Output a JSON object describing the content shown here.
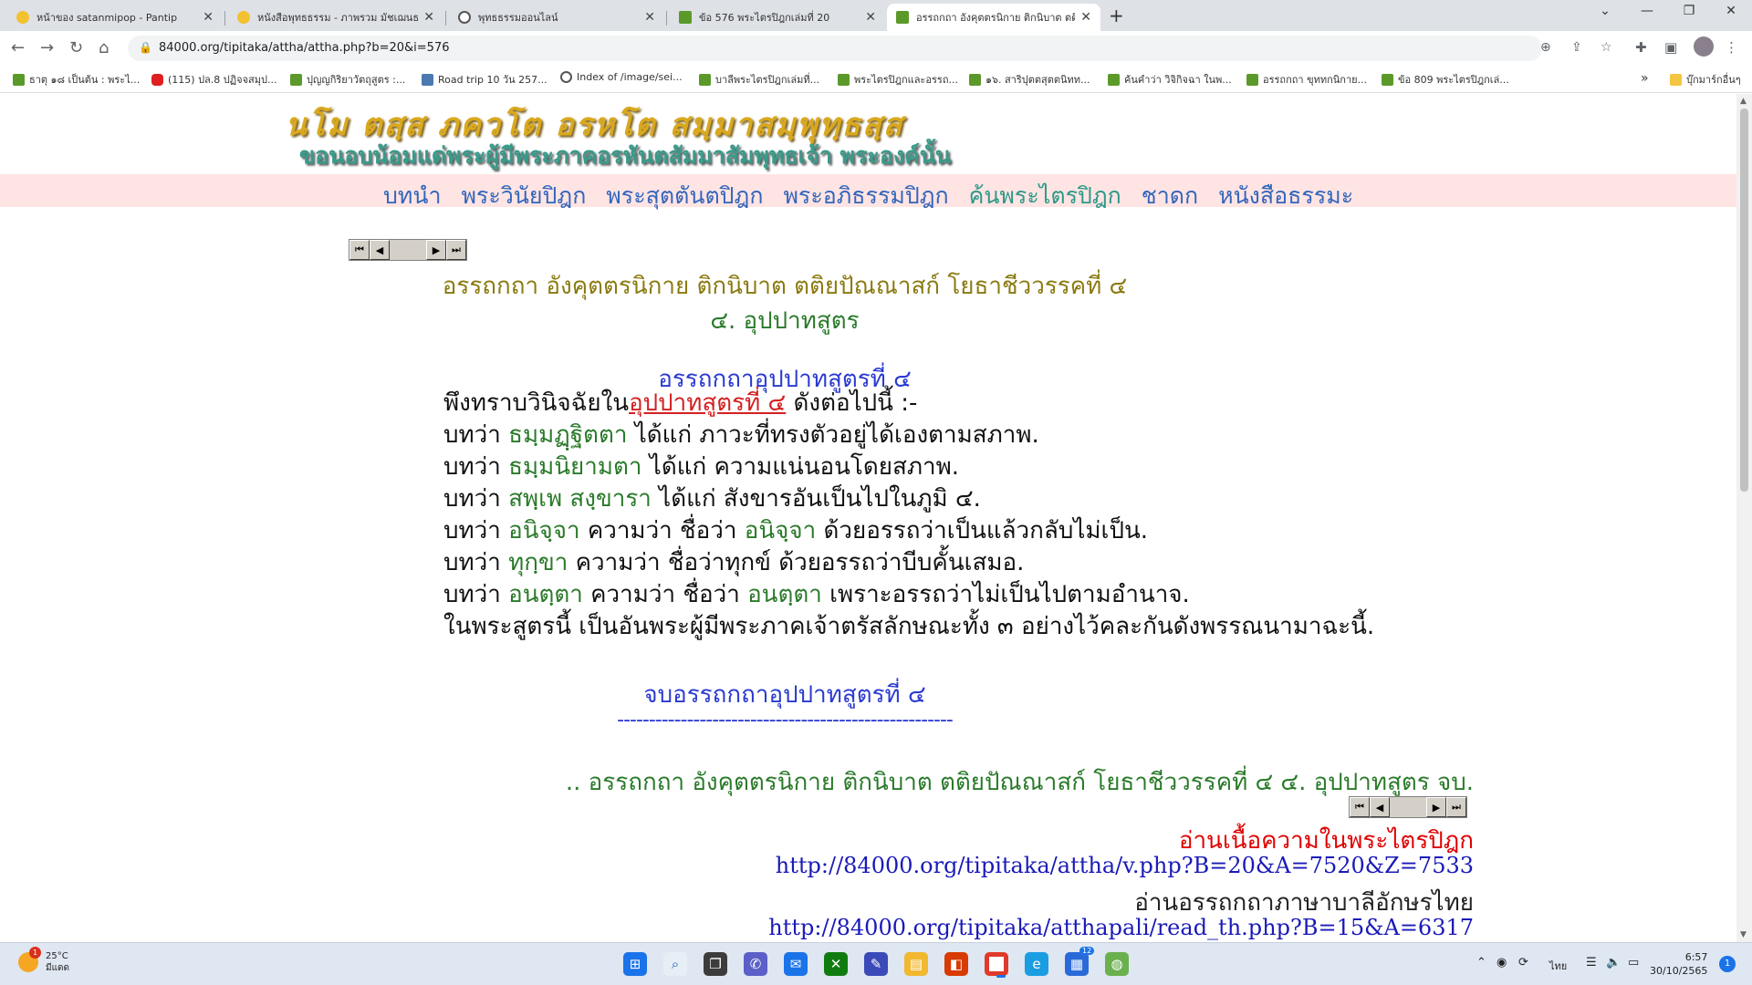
{
  "browser": {
    "tabs": [
      {
        "title": "หน้าของ satanmipop - Pantip"
      },
      {
        "title": "หนังสือพุทธธรรม - ภาพรวม มัชเฌนธ"
      },
      {
        "title": "พุทธธรรมออนไลน์"
      },
      {
        "title": "ข้อ 576 พระไตรปิฎกเล่มที่ 20"
      },
      {
        "title": "อรรถกถา อังคุตตรนิกาย ติกนิบาต ตติ"
      }
    ],
    "url": "84000.org/tipitaka/attha/attha.php?b=20&i=576",
    "bookmarks": [
      "ธาตุ ๑๘ เป็นต้น : พระไ...",
      "(115) ปล.8 ปฏิจจสมุป...",
      "ปุญญกิริยาวัตถุสูตร :...",
      "Road trip 10 วัน 257...",
      "Index of /image/sei...",
      "บาลีพระไตรปิฎกเล่มที่...",
      "พระไตรปิฎกและอรรถ...",
      "๑๖. สาริปุตตสุตตนิทท...",
      "ค้นคำว่า วิจิกิจฉา ในพ...",
      "อรรถกถา ขุททกนิกาย...",
      "ข้อ 809 พระไตรปิฎกเล่..."
    ],
    "bookmarks_overflow": "»",
    "other_bookmarks": "บุ๊กมาร์กอื่นๆ"
  },
  "banner": {
    "pali": "นโม ตสฺส ภควโต อรหโต สมฺมาสมฺพุทฺธสฺส",
    "thai": "ขอนอบน้อมแด่พระผู้มีพระภาคอรหันตสัมมาสัมพุทธเจ้า  พระองค์นั้น"
  },
  "menu": [
    {
      "label": "บทนำ"
    },
    {
      "label": "พระวินัยปิฎก"
    },
    {
      "label": "พระสุตตันตปิฎก"
    },
    {
      "label": "พระอภิธรรมปิฎก"
    },
    {
      "label": "ค้นพระไตรปิฎก"
    },
    {
      "label": "ชาดก"
    },
    {
      "label": "หนังสือธรรมะ"
    }
  ],
  "content": {
    "title": "อรรถกถา อังคุตตรนิกาย ติกนิบาต ตติยปัณณาสก์ โยธาชีววรรคที่ ๔",
    "subtitle": "๔. อุปปาทสูตร",
    "section_title": "อรรถกถาอุปปาทสูตรที่ ๔",
    "intro_prefix": "พึงทราบวินิจฉัยใน",
    "intro_link": "อุปปาทสูตรที่ ๔",
    "intro_suffix": " ดังต่อไปนี้ :-",
    "lines": [
      {
        "pre": "บทว่า ",
        "p1": "ธมฺมฏฺฐิตตา",
        "mid": " ได้แก่ ภาวะที่ทรงตัวอยู่ได้เองตามสภาพ.",
        "p2": "",
        "post": ""
      },
      {
        "pre": "บทว่า ",
        "p1": "ธมฺมนิยามตา",
        "mid": " ได้แก่ ความแน่นอนโดยสภาพ.",
        "p2": "",
        "post": ""
      },
      {
        "pre": "บทว่า ",
        "p1": "สพฺเพ สงฺขารา",
        "mid": " ได้แก่ สังขารอันเป็นไปในภูมิ ๔.",
        "p2": "",
        "post": ""
      },
      {
        "pre": "บทว่า ",
        "p1": "อนิจฺจา",
        "mid": " ความว่า ชื่อว่า ",
        "p2": "อนิจฺจา",
        "post": " ด้วยอรรถว่าเป็นแล้วกลับไม่เป็น."
      },
      {
        "pre": "บทว่า ",
        "p1": "ทุกฺขา",
        "mid": " ความว่า ชื่อว่าทุกข์ ด้วยอรรถว่าบีบคั้นเสมอ.",
        "p2": "",
        "post": ""
      },
      {
        "pre": "บทว่า ",
        "p1": "อนตฺตา",
        "mid": " ความว่า ชื่อว่า ",
        "p2": "อนตฺตา",
        "post": " เพราะอรรถว่าไม่เป็นไปตามอำนาจ."
      }
    ],
    "conclusion": "ในพระสูตรนี้ เป็นอันพระผู้มีพระภาคเจ้าตรัสลักษณะทั้ง ๓ อย่างไว้คละกันดังพรรณนามาฉะนี้.",
    "end_title": "จบอรรถกถาอุปปาทสูตรที่ ๔",
    "dashes": "-----------------------------------------------------",
    "closing": ".. อรรถกถา อังคุตตรนิกาย ติกนิบาต ตติยปัณณาสก์ โยธาชีววรรคที่ ๔ ๔. อุปปาทสูตร จบ.",
    "read_canon_label": "อ่านเนื้อความในพระไตรปิฎก",
    "read_canon_url": "http://84000.org/tipitaka/attha/v.php?B=20&A=7520&Z=7533",
    "read_pali_label": "อ่านอรรถกถาภาษาบาลีอักษรไทย",
    "read_pali_url": "http://84000.org/tipitaka/atthapali/read_th.php?B=15&A=6317"
  },
  "pager": {
    "first": "⏮",
    "prev": "◀",
    "next": "▶",
    "last": "⏭"
  },
  "taskbar": {
    "weather_temp": "25°C",
    "weather_desc": "มีแดด",
    "weather_badge": "1",
    "store_badge": "12",
    "lang": "ไทย",
    "time": "6:57",
    "date": "30/10/2565",
    "notifications": "1"
  },
  "colors": {
    "menu_bg": "#ffe4e4",
    "pali_green": "#2a7a2a",
    "heading_blue": "#2a3ad0",
    "link_red": "#d42020",
    "banner_gold": "#d9a81e"
  }
}
